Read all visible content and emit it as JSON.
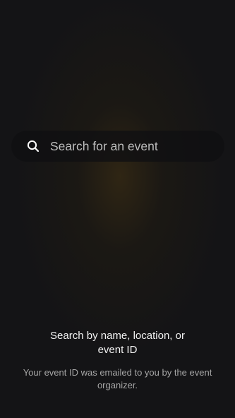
{
  "search": {
    "placeholder": "Search for an event",
    "icon": "search-icon"
  },
  "hint": {
    "title": "Search by name, location, or event ID",
    "subtitle": "Your event ID was emailed to you by the event organizer."
  },
  "colors": {
    "background": "#141416",
    "glow": "#46340f",
    "title_text": "#f2f2f2",
    "subtitle_text": "#a6a6a6"
  }
}
